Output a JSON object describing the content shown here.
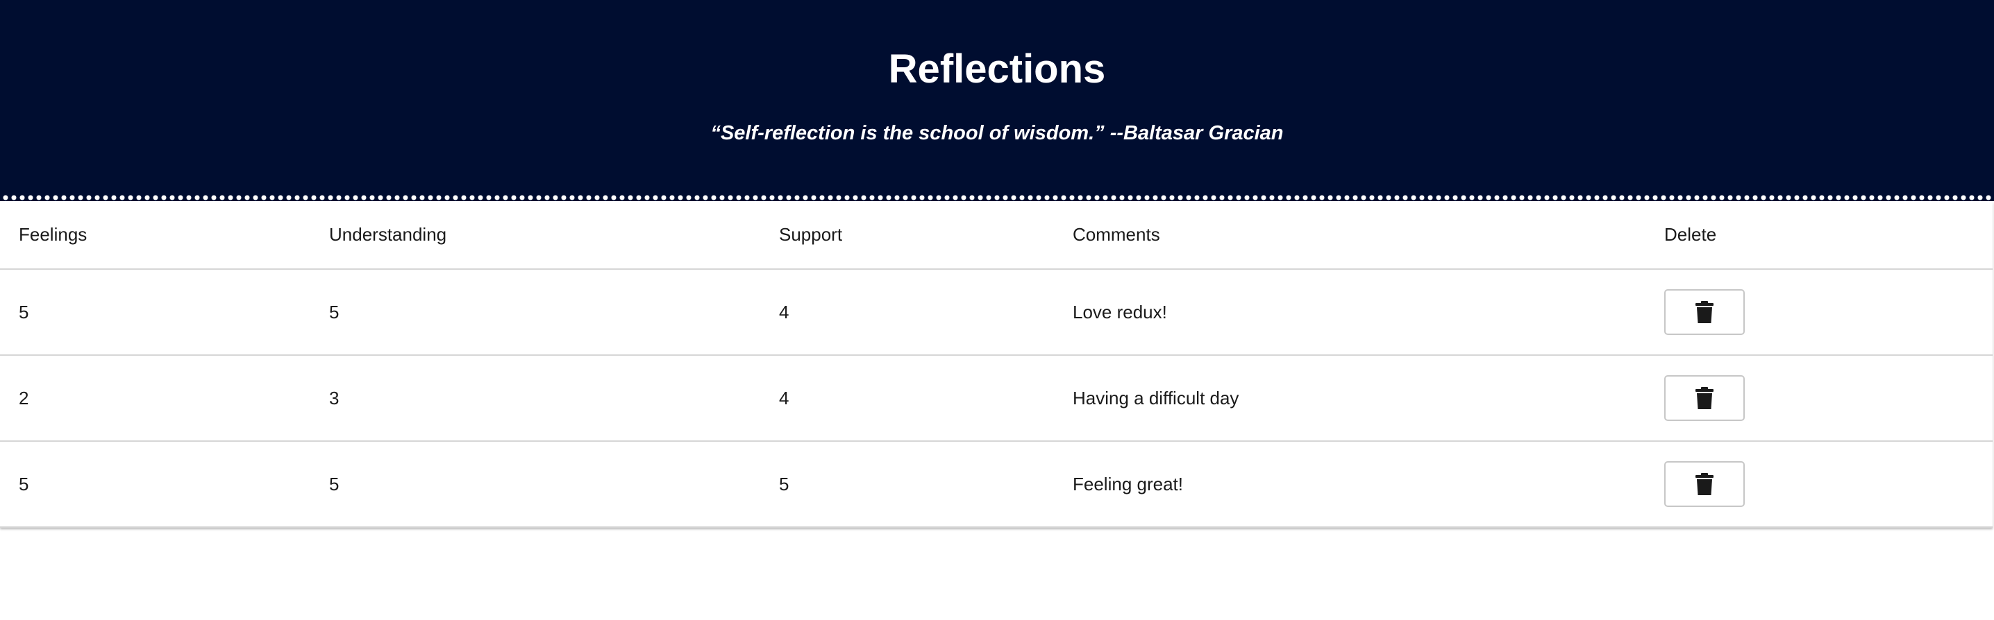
{
  "header": {
    "title": "Reflections",
    "quote": "“Self-reflection is the school of wisdom.” --Baltasar Gracian"
  },
  "table": {
    "columns": [
      "Feelings",
      "Understanding",
      "Support",
      "Comments",
      "Delete"
    ],
    "rows": [
      {
        "feelings": "5",
        "understanding": "5",
        "support": "4",
        "comments": "Love redux!"
      },
      {
        "feelings": "2",
        "understanding": "3",
        "support": "4",
        "comments": "Having a difficult day"
      },
      {
        "feelings": "5",
        "understanding": "5",
        "support": "5",
        "comments": "Feeling great!"
      }
    ],
    "delete_icon": "trash-icon"
  },
  "colors": {
    "header_background": "#000d30",
    "header_text": "#ffffff",
    "row_border": "#d6d6d6",
    "icon": "#1a1a1a"
  }
}
